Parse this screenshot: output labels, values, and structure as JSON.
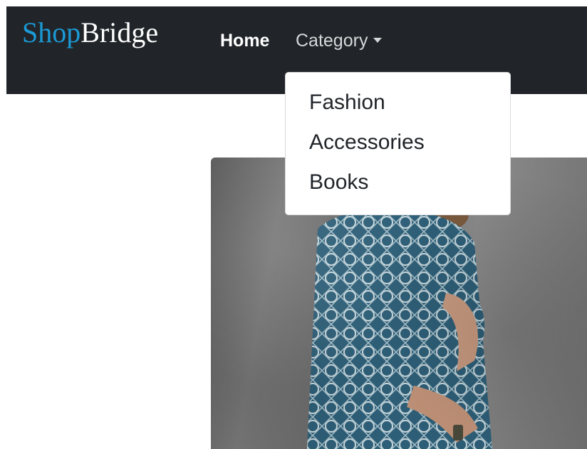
{
  "navbar": {
    "brand_part1": "Shop",
    "brand_part2": "Bridge",
    "home_label": "Home",
    "category_label": "Category"
  },
  "dropdown": {
    "items": [
      {
        "label": "Fashion"
      },
      {
        "label": "Accessories"
      },
      {
        "label": "Books"
      }
    ]
  },
  "hero": {
    "image": "model-in-patterned-shirt-photo"
  },
  "colors": {
    "navbar_bg": "#212529",
    "brand_accent": "#1b9ad6",
    "text_dark": "#212529"
  }
}
